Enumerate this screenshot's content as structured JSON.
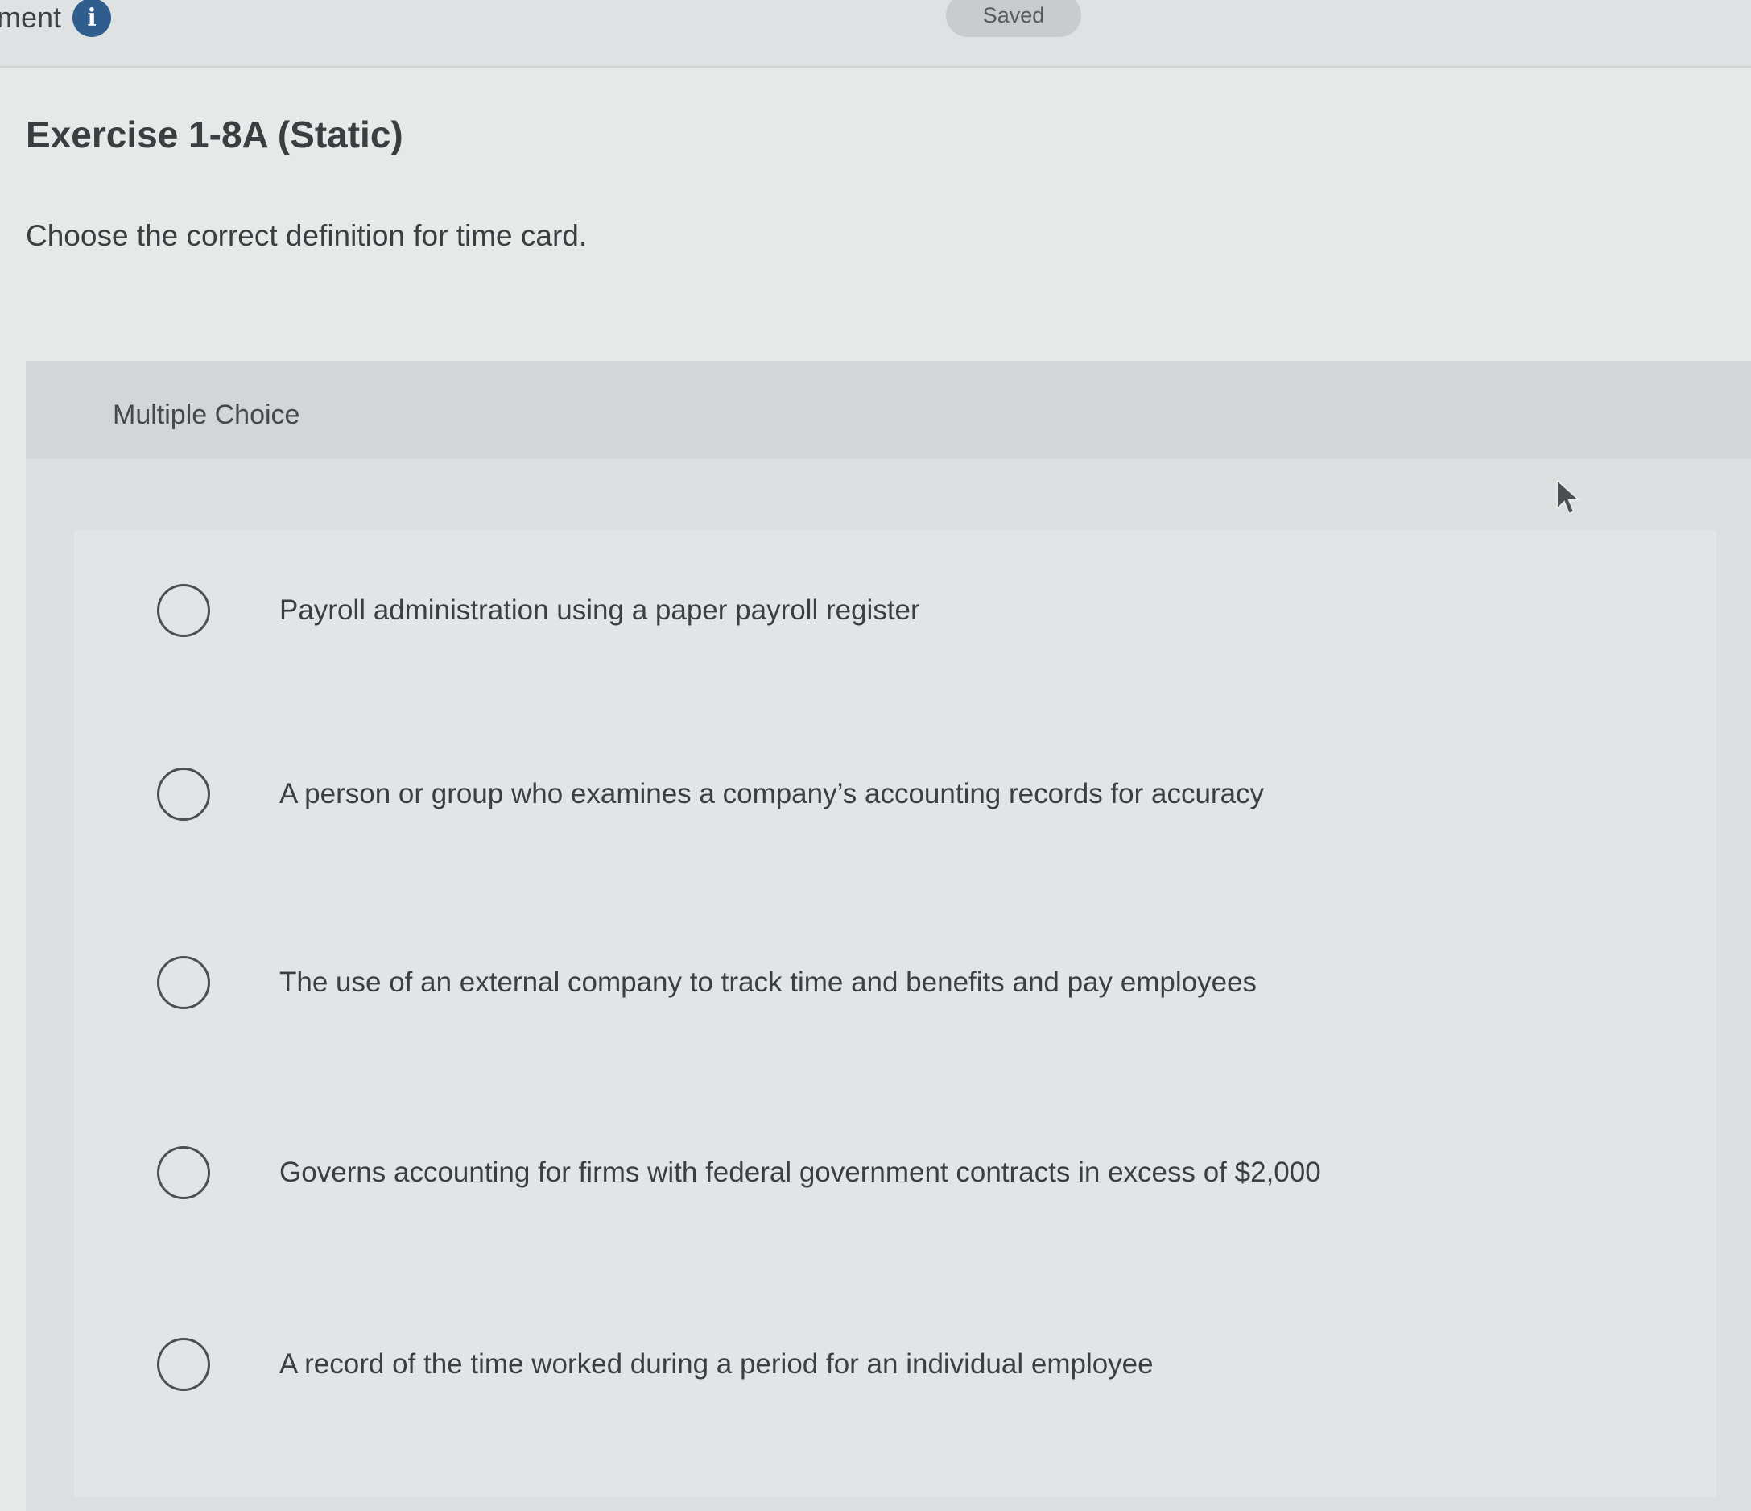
{
  "header": {
    "title_fragment": "ment",
    "info_icon": "info-icon",
    "status": "Saved"
  },
  "exercise": {
    "title": "Exercise 1-8A (Static)",
    "question": "Choose the correct definition for time card."
  },
  "multiple_choice": {
    "label": "Multiple Choice",
    "options": [
      {
        "text": "Payroll administration using a paper payroll register",
        "selected": false
      },
      {
        "text": "A person or group who examines a company’s accounting records for accuracy",
        "selected": false
      },
      {
        "text": "The use of an external company to track time and benefits and pay employees",
        "selected": false
      },
      {
        "text": "Governs accounting for firms with federal government contracts in excess of $2,000",
        "selected": false
      },
      {
        "text": "A record of the time worked during a period for an individual employee",
        "selected": false
      }
    ]
  },
  "colors": {
    "info_icon": "#2e5d8e",
    "background": "#e4e6e6",
    "text": "#3b3e41"
  },
  "icons": [
    "info-icon",
    "radio-icon",
    "mouse-cursor-icon"
  ]
}
